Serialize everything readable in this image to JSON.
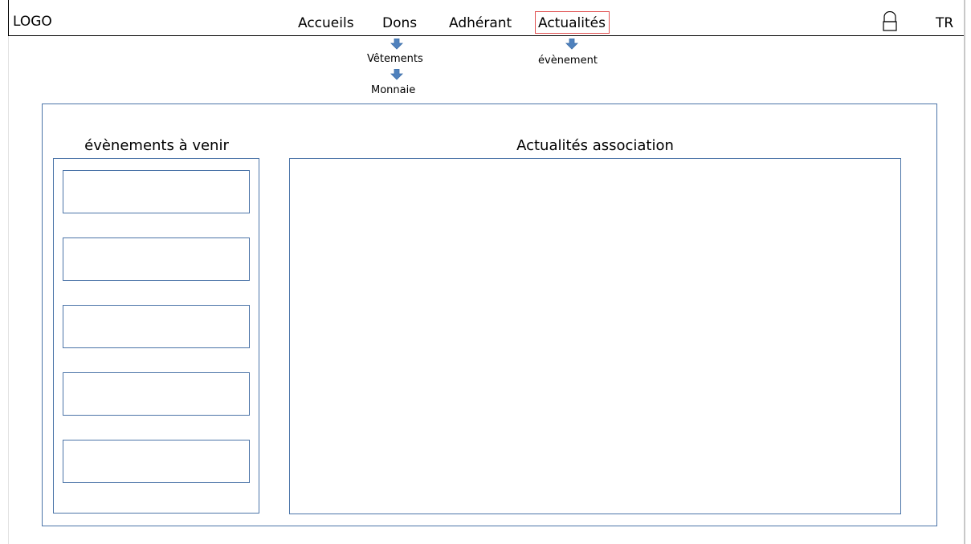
{
  "header": {
    "logo": "LOGO",
    "nav": {
      "accueils": "Accueils",
      "dons": "Dons",
      "adherant": "Adhérant",
      "actualites": "Actualités"
    },
    "lang": "TR"
  },
  "submenus": {
    "dons": [
      "Vêtements",
      "Monnaie"
    ],
    "actualites": [
      "évènement"
    ]
  },
  "main": {
    "events_title": "évènements à venir",
    "news_title": "Actualités association",
    "event_cards_count": 5
  },
  "colors": {
    "frame_border": "#4b74a8",
    "arrow": "#4f81bd",
    "active_nav_border": "#e05050"
  },
  "icons": {
    "user": "user-icon",
    "arrow": "arrow-down-icon"
  }
}
